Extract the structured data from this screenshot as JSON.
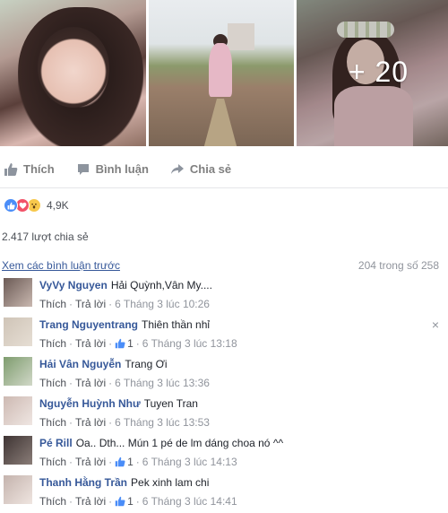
{
  "photos": {
    "more_count": "+ 20"
  },
  "actions": {
    "like": "Thích",
    "comment": "Bình luận",
    "share": "Chia sẻ"
  },
  "reactions": {
    "count": "4,9K",
    "icons": [
      "like-icon",
      "love-icon",
      "wow-icon"
    ],
    "colors": {
      "like": "#4a8df8",
      "love": "#f25268",
      "wow": "#f7c84c"
    }
  },
  "shares": {
    "text": "2.417 lượt chia sẻ"
  },
  "comments_header": {
    "view_previous": "Xem các bình luận trước",
    "count": "204 trong số 258"
  },
  "comments": [
    {
      "author": "VyVy Nguyen",
      "text": "Hải Quỳnh,Vân My....",
      "like": "Thích",
      "reply": "Trả lời",
      "likes": "",
      "time": "6 Tháng 3 lúc 10:26"
    },
    {
      "author": "Trang Nguyentrang",
      "text": "Thiên thần nhỉ",
      "like": "Thích",
      "reply": "Trả lời",
      "likes": "1",
      "time": "6 Tháng 3 lúc 13:18",
      "close": "×"
    },
    {
      "author": "Hải Vân Nguyễn",
      "text": "Trang Ơi",
      "like": "Thích",
      "reply": "Trả lời",
      "likes": "",
      "time": "6 Tháng 3 lúc 13:36"
    },
    {
      "author": "Nguyễn Huỳnh Như",
      "text": "Tuyen Tran",
      "like": "Thích",
      "reply": "Trả lời",
      "likes": "",
      "time": "6 Tháng 3 lúc 13:53"
    },
    {
      "author": "Pé Rill",
      "text": "Oa.. Dth... Mún 1 pé de lm dáng choa nó ^^",
      "like": "Thích",
      "reply": "Trả lời",
      "likes": "1",
      "time": "6 Tháng 3 lúc 14:13"
    },
    {
      "author": "Thanh Hằng Trần",
      "text": "Pek xinh lam chi",
      "like": "Thích",
      "reply": "Trả lời",
      "likes": "1",
      "time": "6 Tháng 3 lúc 14:41"
    }
  ]
}
